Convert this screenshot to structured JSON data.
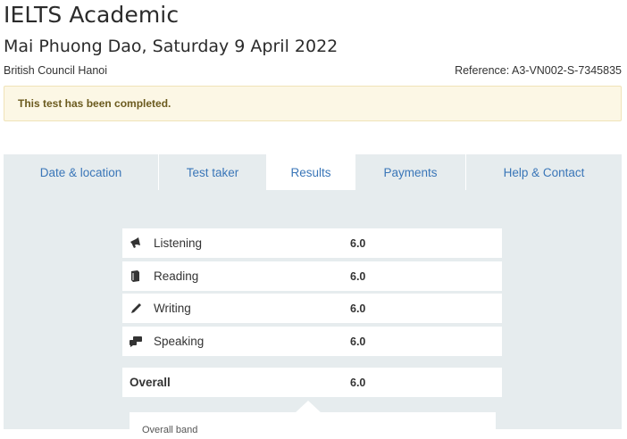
{
  "header": {
    "title": "IELTS Academic",
    "subtitle": "Mai Phuong Dao, Saturday 9 April 2022",
    "centre": "British Council Hanoi",
    "reference": "Reference: A3-VN002-S-7345835"
  },
  "notice": {
    "text": "This test has been completed."
  },
  "tabs": [
    {
      "label": "Date & location",
      "active": false
    },
    {
      "label": "Test taker",
      "active": false
    },
    {
      "label": "Results",
      "active": true
    },
    {
      "label": "Payments",
      "active": false
    },
    {
      "label": "Help & Contact",
      "active": false
    }
  ],
  "results": {
    "rows": [
      {
        "label": "Listening",
        "score": "6.0",
        "icon": "megaphone-icon"
      },
      {
        "label": "Reading",
        "score": "6.0",
        "icon": "book-icon"
      },
      {
        "label": "Writing",
        "score": "6.0",
        "icon": "pencil-icon"
      },
      {
        "label": "Speaking",
        "score": "6.0",
        "icon": "speech-bubbles-icon"
      }
    ],
    "overall": {
      "label": "Overall",
      "score": "6.0"
    },
    "cut_off_text": "Overall band"
  },
  "colors": {
    "tab_text": "#3a76b8",
    "panel_bg": "#e6ecee",
    "notice_bg": "#fcf7e5"
  }
}
